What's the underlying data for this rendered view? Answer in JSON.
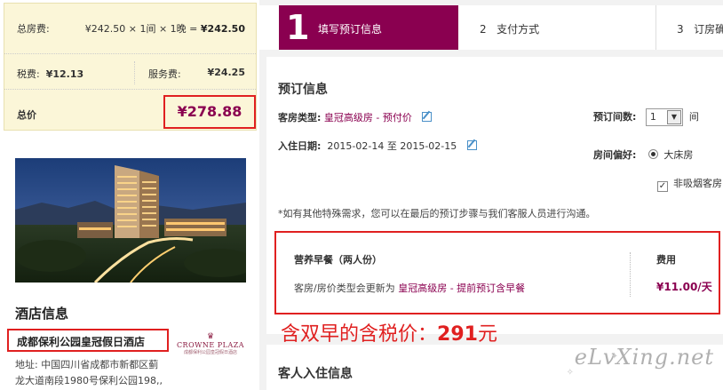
{
  "price": {
    "room_fee_label": "总房费:",
    "room_fee_calc": "¥242.50 × 1间 × 1晚 =",
    "room_fee_total": "¥242.50",
    "tax_label": "税费:",
    "tax_value": "¥12.13",
    "service_label": "服务费:",
    "service_value": "¥24.25",
    "total_label": "总价",
    "total_value": "¥278.88"
  },
  "hotel": {
    "section_title": "酒店信息",
    "name": "成都保利公园皇冠假日酒店",
    "logo_text": "CROWNE PLAZA",
    "logo_sub": "成都保利公园皇冠假日酒店",
    "address_line1": "地址: 中国四川省成都市新都区蓟",
    "address_line2": "龙大道南段1980号保利公园198,,"
  },
  "steps": [
    {
      "num": "1",
      "label": "填写预订信息"
    },
    {
      "num": "2",
      "label": "支付方式"
    },
    {
      "num": "3",
      "label": "订房确"
    }
  ],
  "booking": {
    "title": "预订信息",
    "room_type_label": "客房类型:",
    "room_type_value": "皇冠高级房 - 预付价",
    "date_label": "入住日期:",
    "date_value": "2015-02-14 至 2015-02-15",
    "rooms_label": "预订间数:",
    "rooms_value": "1",
    "rooms_unit": "间",
    "pref_label": "房间偏好:",
    "pref_bed": "大床房",
    "pref_nosmoke": "非吸烟客房",
    "note": "*如有其他特殊需求，您可以在最后的预订步骤与我们客服人员进行沟通。"
  },
  "breakfast": {
    "title": "营养早餐（两人份）",
    "desc_prefix": "客房/房价类型会更新为",
    "desc_link": "皇冠高级房 - 提前预订含早餐",
    "fee_label": "费用",
    "fee_value": "¥11.00/天"
  },
  "annotation": {
    "prefix": "含双早的含税价：",
    "amount": "291",
    "suffix": "元"
  },
  "guest": {
    "title": "客人入住信息"
  },
  "watermark": "eLvXing.net",
  "colors": {
    "brand": "#8a0050",
    "highlight_red": "#e02020",
    "price_bg": "#fbf6d8"
  }
}
